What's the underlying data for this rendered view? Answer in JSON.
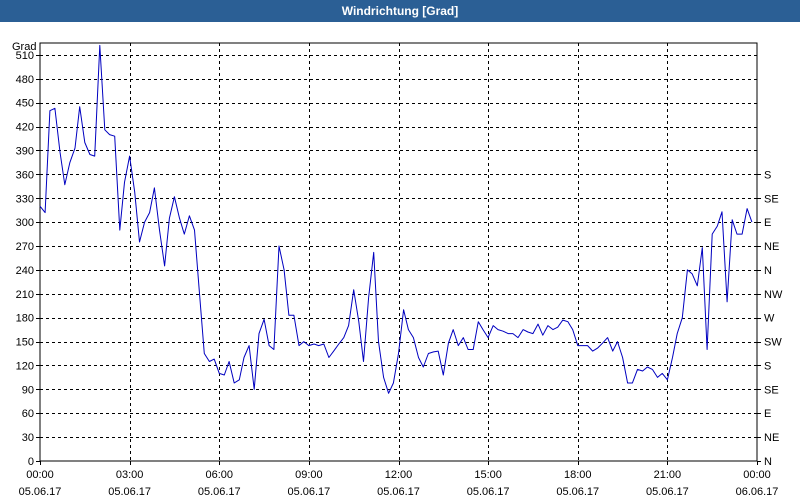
{
  "window": {
    "title": "Windrichtung [Grad]"
  },
  "chart_data": {
    "type": "line",
    "title": "Windrichtung [Grad]",
    "ylabel": "Grad",
    "ylim": [
      0,
      525
    ],
    "xlim": [
      0,
      24
    ],
    "grid": true,
    "y_ticks": [
      0,
      30,
      60,
      90,
      120,
      150,
      180,
      210,
      240,
      270,
      300,
      330,
      360,
      390,
      420,
      450,
      480,
      510
    ],
    "right_ticks": [
      {
        "value": 0,
        "label": "N"
      },
      {
        "value": 30,
        "label": "NE"
      },
      {
        "value": 60,
        "label": "E"
      },
      {
        "value": 90,
        "label": "SE"
      },
      {
        "value": 120,
        "label": "S"
      },
      {
        "value": 150,
        "label": "SW"
      },
      {
        "value": 180,
        "label": "W"
      },
      {
        "value": 210,
        "label": "NW"
      },
      {
        "value": 240,
        "label": "N"
      },
      {
        "value": 270,
        "label": "NE"
      },
      {
        "value": 300,
        "label": "E"
      },
      {
        "value": 330,
        "label": "SE"
      },
      {
        "value": 360,
        "label": "S"
      }
    ],
    "x_ticks": [
      {
        "value": 0,
        "time": "00:00",
        "date": "05.06.17"
      },
      {
        "value": 3,
        "time": "03:00",
        "date": "05.06.17"
      },
      {
        "value": 6,
        "time": "06:00",
        "date": "05.06.17"
      },
      {
        "value": 9,
        "time": "09:00",
        "date": "05.06.17"
      },
      {
        "value": 12,
        "time": "12:00",
        "date": "05.06.17"
      },
      {
        "value": 15,
        "time": "15:00",
        "date": "05.06.17"
      },
      {
        "value": 18,
        "time": "18:00",
        "date": "05.06.17"
      },
      {
        "value": 21,
        "time": "21:00",
        "date": "05.06.17"
      },
      {
        "value": 24,
        "time": "00:00",
        "date": "06.06.17"
      }
    ],
    "series": [
      {
        "color": "#0000c0",
        "points": [
          [
            0.0,
            320
          ],
          [
            0.17,
            312
          ],
          [
            0.33,
            440
          ],
          [
            0.5,
            443
          ],
          [
            0.67,
            388
          ],
          [
            0.83,
            347
          ],
          [
            1.0,
            375
          ],
          [
            1.17,
            393
          ],
          [
            1.33,
            445
          ],
          [
            1.5,
            400
          ],
          [
            1.67,
            385
          ],
          [
            1.83,
            383
          ],
          [
            2.0,
            522
          ],
          [
            2.17,
            416
          ],
          [
            2.33,
            410
          ],
          [
            2.5,
            408
          ],
          [
            2.67,
            290
          ],
          [
            2.83,
            350
          ],
          [
            3.0,
            383
          ],
          [
            3.17,
            338
          ],
          [
            3.33,
            275
          ],
          [
            3.5,
            300
          ],
          [
            3.67,
            312
          ],
          [
            3.83,
            343
          ],
          [
            4.0,
            290
          ],
          [
            4.17,
            245
          ],
          [
            4.33,
            305
          ],
          [
            4.5,
            332
          ],
          [
            4.67,
            305
          ],
          [
            4.83,
            285
          ],
          [
            5.0,
            308
          ],
          [
            5.17,
            290
          ],
          [
            5.33,
            215
          ],
          [
            5.5,
            135
          ],
          [
            5.67,
            125
          ],
          [
            5.83,
            128
          ],
          [
            6.0,
            110
          ],
          [
            6.17,
            108
          ],
          [
            6.33,
            125
          ],
          [
            6.5,
            98
          ],
          [
            6.67,
            102
          ],
          [
            6.83,
            130
          ],
          [
            7.0,
            145
          ],
          [
            7.17,
            90
          ],
          [
            7.33,
            160
          ],
          [
            7.5,
            178
          ],
          [
            7.67,
            145
          ],
          [
            7.83,
            140
          ],
          [
            8.0,
            270
          ],
          [
            8.17,
            240
          ],
          [
            8.33,
            183
          ],
          [
            8.5,
            183
          ],
          [
            8.67,
            145
          ],
          [
            8.83,
            150
          ],
          [
            9.0,
            145
          ],
          [
            9.17,
            147
          ],
          [
            9.33,
            145
          ],
          [
            9.5,
            147
          ],
          [
            9.67,
            130
          ],
          [
            9.83,
            138
          ],
          [
            10.0,
            147
          ],
          [
            10.17,
            155
          ],
          [
            10.33,
            170
          ],
          [
            10.5,
            215
          ],
          [
            10.67,
            175
          ],
          [
            10.83,
            125
          ],
          [
            11.0,
            205
          ],
          [
            11.17,
            262
          ],
          [
            11.33,
            150
          ],
          [
            11.5,
            105
          ],
          [
            11.67,
            85
          ],
          [
            11.83,
            98
          ],
          [
            12.0,
            135
          ],
          [
            12.17,
            190
          ],
          [
            12.33,
            165
          ],
          [
            12.5,
            155
          ],
          [
            12.67,
            130
          ],
          [
            12.83,
            118
          ],
          [
            13.0,
            135
          ],
          [
            13.17,
            137
          ],
          [
            13.33,
            138
          ],
          [
            13.5,
            108
          ],
          [
            13.67,
            148
          ],
          [
            13.83,
            165
          ],
          [
            14.0,
            145
          ],
          [
            14.17,
            155
          ],
          [
            14.33,
            140
          ],
          [
            14.5,
            140
          ],
          [
            14.67,
            175
          ],
          [
            14.83,
            165
          ],
          [
            15.0,
            155
          ],
          [
            15.17,
            170
          ],
          [
            15.33,
            165
          ],
          [
            15.5,
            163
          ],
          [
            15.67,
            160
          ],
          [
            15.83,
            160
          ],
          [
            16.0,
            155
          ],
          [
            16.17,
            165
          ],
          [
            16.33,
            162
          ],
          [
            16.5,
            160
          ],
          [
            16.67,
            172
          ],
          [
            16.83,
            158
          ],
          [
            17.0,
            170
          ],
          [
            17.17,
            165
          ],
          [
            17.33,
            168
          ],
          [
            17.5,
            177
          ],
          [
            17.67,
            175
          ],
          [
            17.83,
            165
          ],
          [
            18.0,
            145
          ],
          [
            18.17,
            145
          ],
          [
            18.33,
            145
          ],
          [
            18.5,
            138
          ],
          [
            18.67,
            142
          ],
          [
            18.83,
            148
          ],
          [
            19.0,
            155
          ],
          [
            19.17,
            138
          ],
          [
            19.33,
            150
          ],
          [
            19.5,
            130
          ],
          [
            19.67,
            98
          ],
          [
            19.83,
            98
          ],
          [
            20.0,
            115
          ],
          [
            20.17,
            113
          ],
          [
            20.33,
            118
          ],
          [
            20.5,
            115
          ],
          [
            20.67,
            105
          ],
          [
            20.83,
            110
          ],
          [
            21.0,
            102
          ],
          [
            21.17,
            130
          ],
          [
            21.33,
            160
          ],
          [
            21.5,
            180
          ],
          [
            21.67,
            240
          ],
          [
            21.83,
            235
          ],
          [
            22.0,
            220
          ],
          [
            22.17,
            268
          ],
          [
            22.33,
            140
          ],
          [
            22.5,
            285
          ],
          [
            22.67,
            295
          ],
          [
            22.83,
            313
          ],
          [
            23.0,
            200
          ],
          [
            23.17,
            303
          ],
          [
            23.33,
            285
          ],
          [
            23.5,
            285
          ],
          [
            23.67,
            317
          ],
          [
            23.83,
            300
          ]
        ]
      }
    ]
  }
}
